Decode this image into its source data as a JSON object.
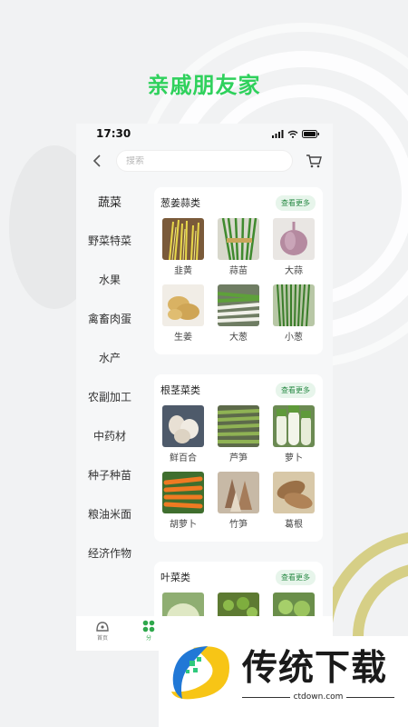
{
  "promo": {
    "title": "亲戚朋友家"
  },
  "status": {
    "time": "17:30"
  },
  "search": {
    "placeholder": "搜索"
  },
  "sidebar": {
    "items": [
      {
        "label": "蔬菜",
        "active": true
      },
      {
        "label": "野菜特菜"
      },
      {
        "label": "水果"
      },
      {
        "label": "禽畜肉蛋"
      },
      {
        "label": "水产"
      },
      {
        "label": "农副加工"
      },
      {
        "label": "中药材"
      },
      {
        "label": "种子种苗"
      },
      {
        "label": "粮油米面"
      },
      {
        "label": "经济作物"
      }
    ]
  },
  "categories": [
    {
      "title": "葱姜蒜类",
      "more_label": "查看更多",
      "products": [
        {
          "name": "韭黄",
          "image": "garlic-chives-yellow"
        },
        {
          "name": "蒜苗",
          "image": "garlic-sprouts"
        },
        {
          "name": "大蒜",
          "image": "garlic-bulb"
        },
        {
          "name": "生姜",
          "image": "ginger"
        },
        {
          "name": "大葱",
          "image": "green-onion"
        },
        {
          "name": "小葱",
          "image": "scallion"
        }
      ]
    },
    {
      "title": "根茎菜类",
      "more_label": "查看更多",
      "products": [
        {
          "name": "鲜百合",
          "image": "lily-bulb"
        },
        {
          "name": "芦笋",
          "image": "asparagus"
        },
        {
          "name": "萝卜",
          "image": "radish"
        },
        {
          "name": "胡萝卜",
          "image": "carrot"
        },
        {
          "name": "竹笋",
          "image": "bamboo-shoot"
        },
        {
          "name": "葛根",
          "image": "kudzu-root"
        }
      ]
    },
    {
      "title": "叶菜类",
      "more_label": "查看更多",
      "products": [
        {
          "name": "",
          "image": "cabbage"
        },
        {
          "name": "",
          "image": "bok-choy"
        },
        {
          "name": "",
          "image": "lettuce"
        }
      ]
    }
  ],
  "tabbar": {
    "items": [
      {
        "label": "首页",
        "icon": "home-icon"
      },
      {
        "label": "分",
        "icon": "category-icon",
        "active": true
      }
    ]
  },
  "watermark": {
    "brand": "传统下载",
    "url": "ctdown.com"
  },
  "colors": {
    "accent": "#2fd15c",
    "tab_active": "#2fa84c",
    "more_bg": "#e7f5eb"
  }
}
